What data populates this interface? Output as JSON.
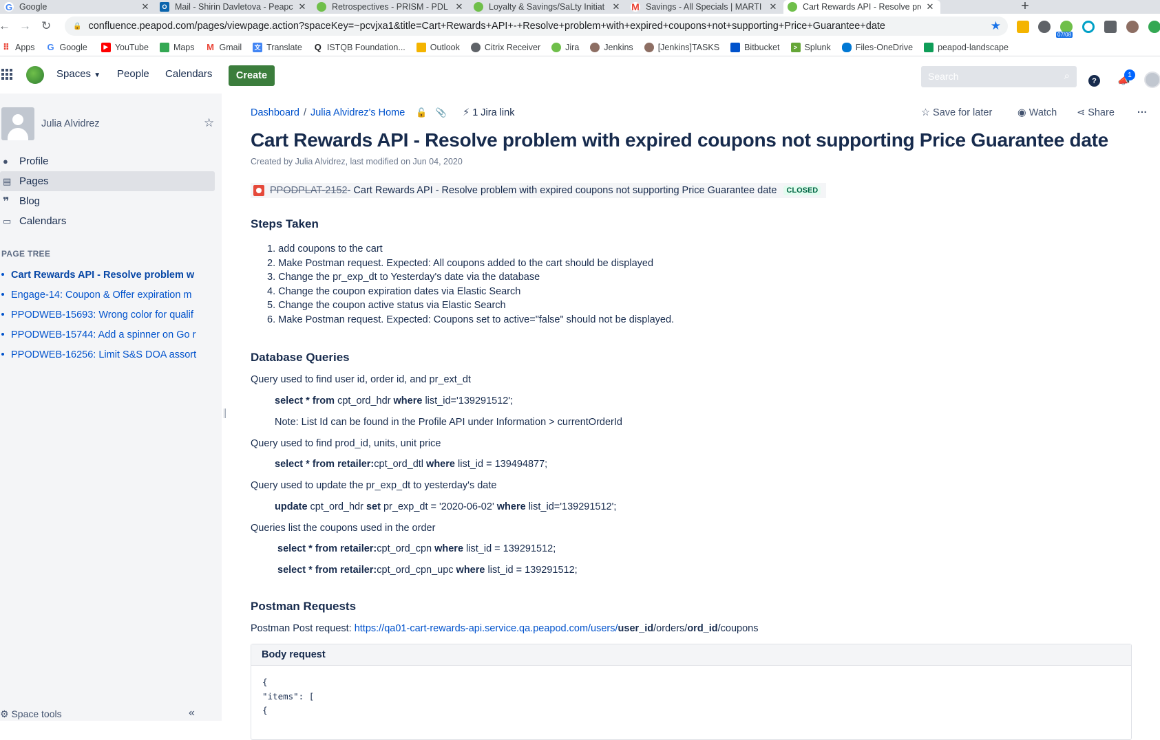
{
  "browser": {
    "tabs": [
      {
        "label": "Google",
        "active": false,
        "color": "#4285f4",
        "glyph": "G"
      },
      {
        "label": "Mail - Shirin Davletova - Peapc",
        "active": false,
        "color": "#0a64ad",
        "glyph": "O"
      },
      {
        "label": "Retrospectives - PRISM - PDL",
        "active": false,
        "color": "#6fbf4a",
        "glyph": ""
      },
      {
        "label": "Loyalty & Savings/SaLty Initiat",
        "active": false,
        "color": "#6fbf4a",
        "glyph": ""
      },
      {
        "label": "Savings - All Specials | MARTI",
        "active": false,
        "color": "#ea4335",
        "glyph": "M"
      },
      {
        "label": "Cart Rewards API - Resolve pro",
        "active": true,
        "color": "#6fbf4a",
        "glyph": ""
      }
    ],
    "url": "confluence.peapod.com/pages/viewpage.action?spaceKey=~pcvjxa1&title=Cart+Rewards+API+-+Resolve+problem+with+expired+coupons+not+supporting+Price+Guarantee+date",
    "bookmarks": [
      {
        "label": "Apps",
        "icon": "apps-grid-icon",
        "color": "#ea4335"
      },
      {
        "label": "Google",
        "icon": "google-icon",
        "color": "#4285f4"
      },
      {
        "label": "YouTube",
        "icon": "youtube-icon",
        "color": "#ff0000"
      },
      {
        "label": "Maps",
        "icon": "maps-icon",
        "color": "#34a853"
      },
      {
        "label": "Gmail",
        "icon": "gmail-icon",
        "color": "#ea4335"
      },
      {
        "label": "Translate",
        "icon": "translate-icon",
        "color": "#4285f4"
      },
      {
        "label": "ISTQB Foundation...",
        "icon": "istqb-icon",
        "color": "#202124"
      },
      {
        "label": "Outlook",
        "icon": "outlook-icon",
        "color": "#f4b400"
      },
      {
        "label": "Citrix Receiver",
        "icon": "citrix-icon",
        "color": "#5f6368"
      },
      {
        "label": "Jira",
        "icon": "jira-icon",
        "color": "#6fbf4a"
      },
      {
        "label": "Jenkins",
        "icon": "jenkins-icon",
        "color": "#8d6e63"
      },
      {
        "label": "[Jenkins]TASKS",
        "icon": "jenkins-icon",
        "color": "#8d6e63"
      },
      {
        "label": "Bitbucket",
        "icon": "bitbucket-icon",
        "color": "#0052cc"
      },
      {
        "label": "Splunk",
        "icon": "splunk-icon",
        "color": "#65a637"
      },
      {
        "label": "Files-OneDrive",
        "icon": "onedrive-icon",
        "color": "#0078d4"
      },
      {
        "label": "peapod-landscape",
        "icon": "sheets-icon",
        "color": "#0f9d58"
      }
    ],
    "extension_badge": "07/08"
  },
  "nav": {
    "spaces": "Spaces",
    "people": "People",
    "calendars": "Calendars",
    "create": "Create",
    "search_placeholder": "Search",
    "notification_count": "1",
    "accent": "#3b7d3c"
  },
  "sidebar": {
    "user": "Julia Alvidrez",
    "items": [
      {
        "label": "Profile",
        "icon": "person-icon"
      },
      {
        "label": "Pages",
        "icon": "pages-icon"
      },
      {
        "label": "Blog",
        "icon": "quote-icon"
      },
      {
        "label": "Calendars",
        "icon": "calendar-icon"
      }
    ],
    "section_title": "PAGE TREE",
    "tree": [
      "Cart Rewards API - Resolve problem w",
      "Engage-14: Coupon & Offer expiration m",
      "PPODWEB-15693: Wrong color for qualif",
      "PPODWEB-15744: Add a spinner on Go r",
      "PPODWEB-16256: Limit S&S DOA assort"
    ],
    "space_tools": "Space tools"
  },
  "page": {
    "breadcrumb": [
      "Dashboard",
      "Julia Alvidrez's Home"
    ],
    "jira_link": "1 Jira link",
    "save_later": "Save for later",
    "watch": "Watch",
    "share": "Share",
    "title": "Cart Rewards API - Resolve problem with expired coupons not supporting Price Guarantee date",
    "byline": "Created by Julia Alvidrez, last modified on Jun 04, 2020",
    "jira_issue": {
      "key": "PPODPLAT-2152",
      "summary": " - Cart Rewards API - Resolve problem with expired coupons not supporting Price Guarantee date",
      "status": "CLOSED"
    },
    "steps_heading": "Steps Taken",
    "steps": [
      "add coupons to the cart",
      "Make Postman request.  Expected:  All coupons added to the cart should be displayed",
      "Change the pr_exp_dt to Yesterday's date via the database",
      "Change the coupon expiration dates via Elastic Search",
      "Change the coupon active status via Elastic Search",
      "Make Postman request.  Expected:  Coupons set to active=\"false\" should not be displayed."
    ],
    "db_heading": "Database Queries",
    "q1_label": "Query used to find user id, order id, and pr_ext_dt",
    "q1_kw1": "select * from",
    "q1_t1": " cpt_ord_hdr ",
    "q1_kw2": "where",
    "q1_t2": " list_id='139291512';",
    "note": "Note:  List Id can be found in the Profile API under Information > currentOrderId",
    "q2_label": "Query used to find prod_id, units, unit price",
    "q2_kw1": "select * from retailer:",
    "q2_t1": "cpt_ord_dtl ",
    "q2_kw2": "where",
    "q2_t2": " list_id = 139494877;",
    "q3_label": "Query used to update the pr_exp_dt to yesterday's date",
    "q3_kw1": "update",
    "q3_t1": " cpt_ord_hdr ",
    "q3_kw2": "set",
    "q3_t2": " pr_exp_dt = '2020-06-02' ",
    "q3_kw3": "where",
    "q3_t3": " list_id='139291512';",
    "q4_label": "Queries list the coupons used in the order",
    "q4a_kw1": "select * from retailer:",
    "q4a_t1": "cpt_ord_cpn ",
    "q4a_kw2": "where",
    "q4a_t2": " list_id = 139291512;",
    "q4b_kw1": "select * from retailer:",
    "q4b_t1": "cpt_ord_cpn_upc ",
    "q4b_kw2": "where",
    "q4b_t2": " list_id = 139291512;",
    "postman_heading": "Postman Requests",
    "postman_label": "Postman Post request:  ",
    "postman_url": "https://qa01-cart-rewards-api.service.qa.peapod.com/users/",
    "postman_p1": "user_id",
    "postman_p2": "/orders/",
    "postman_p3": "ord_id",
    "postman_p4": "/coupons",
    "body_title": "Body request",
    "body_code": "{\n\"items\": [\n{"
  }
}
